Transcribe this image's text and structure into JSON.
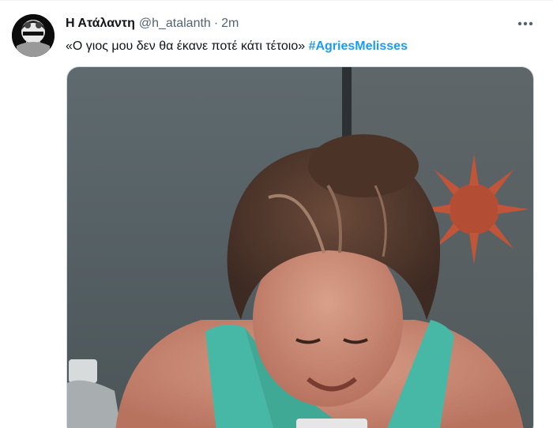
{
  "tweet": {
    "display_name": "Η Ατάλαντη",
    "handle": "@h_atalanth",
    "separator": "·",
    "time": "2m",
    "text": "«Ο γιος μου δεν θα έκανε ποτέ κάτι τέτοιο» ",
    "hashtag": "#AgriesMelisses"
  },
  "icons": {
    "avatar": "avatar-image",
    "more": "more-horizontal-icon"
  },
  "colors": {
    "name": "#0f1419",
    "secondary": "#536471",
    "hashtag": "#1d9bf0",
    "top_wear": "#47b8a5"
  }
}
